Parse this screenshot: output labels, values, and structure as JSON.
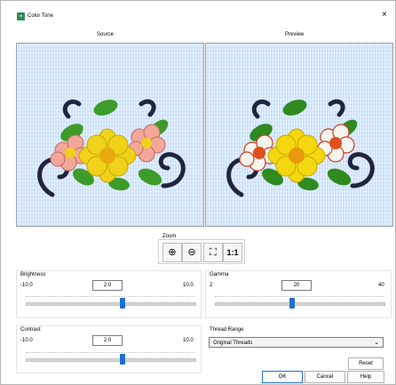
{
  "window": {
    "title": "Color Tone",
    "close_glyph": "×"
  },
  "panes": {
    "source_label": "Source",
    "preview_label": "Preview"
  },
  "zoom": {
    "label": "Zoom",
    "buttons": [
      {
        "icon": "zoom-in-icon",
        "glyph": "⊕"
      },
      {
        "icon": "zoom-out-icon",
        "glyph": "⊖"
      },
      {
        "icon": "zoom-to-fit-icon",
        "glyph": "⛶"
      },
      {
        "icon": "actual-size-icon",
        "glyph": "1:1"
      }
    ]
  },
  "brightness": {
    "label": "Brightness",
    "min": "-10.0",
    "max": "10.0",
    "value": "2.0",
    "level": 0.6
  },
  "contrast": {
    "label": "Contrast",
    "min": "-10.0",
    "max": "10.0",
    "value": "2.0",
    "level": 0.6
  },
  "gamma": {
    "label": "Gamma",
    "min": "2",
    "max": "40",
    "value": "20",
    "level": 0.47
  },
  "thread_range": {
    "label": "Thread Range",
    "selected": "Original Threads"
  },
  "buttons": {
    "reset": "Reset",
    "ok": "OK",
    "cancel": "Cancel",
    "help": "Help"
  },
  "colors": {
    "slider_thumb": "#1e6fd0",
    "fabric": "#d4e6fb",
    "source_petal": "#f2a79a",
    "preview_petal": "#f5f5f0",
    "center": "#f0d21a",
    "leaf": "#3d9b2a",
    "scroll": "#1f2540"
  }
}
